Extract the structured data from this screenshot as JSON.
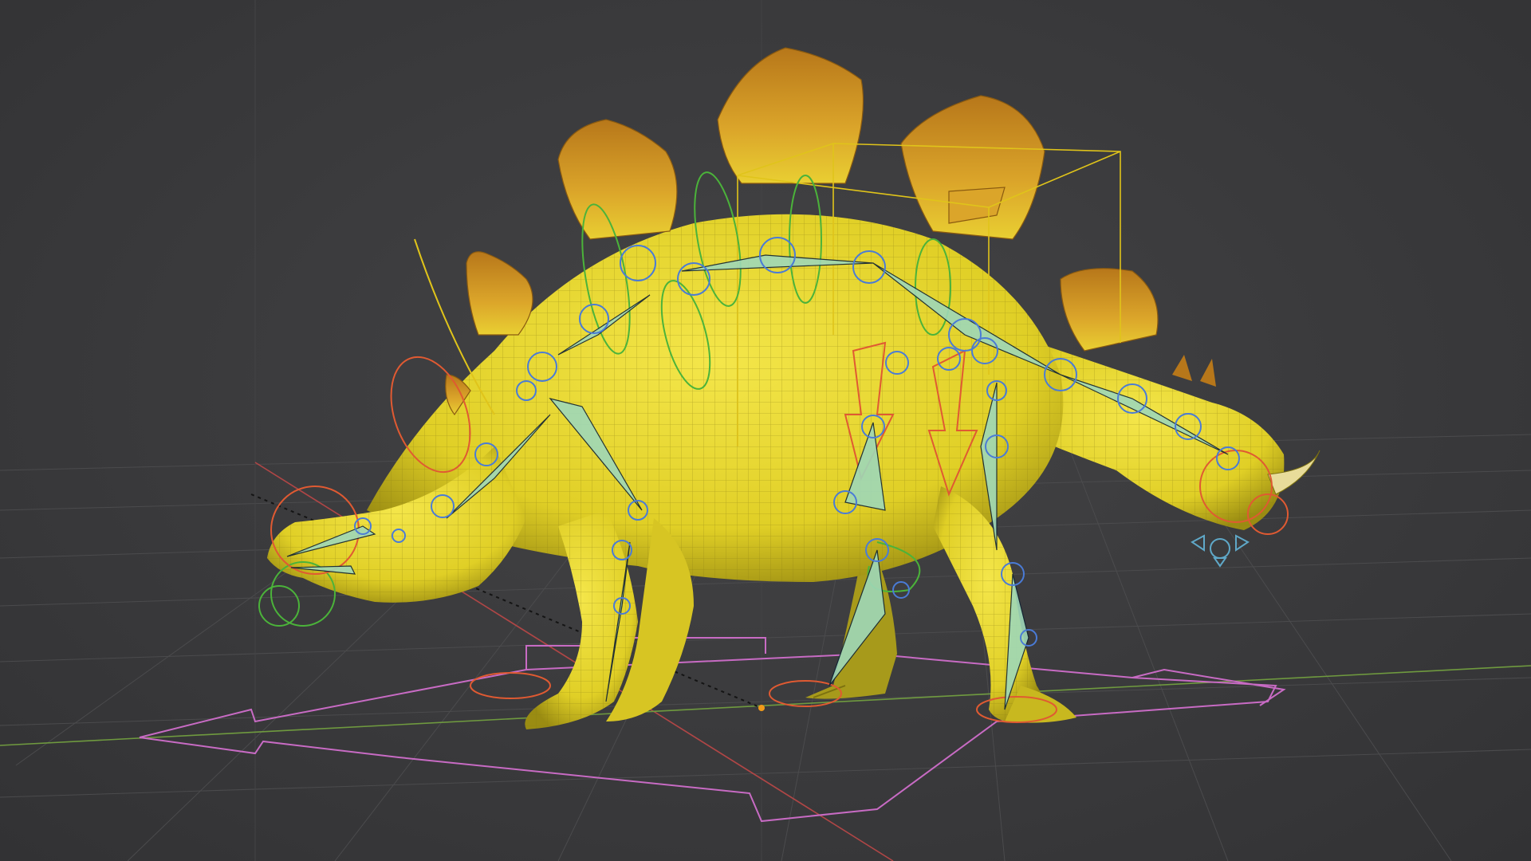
{
  "viewport": {
    "kind": "3d-viewport",
    "background_color": "#3a3a3c",
    "grid_color": "#4b4b4d",
    "x_axis_color": "#b04646",
    "y_axis_color": "#6f9a3f",
    "origin_color": "#f29b1a"
  },
  "model": {
    "subject": "stegosaurus",
    "mesh_color": "#e6d62a",
    "plate_color": "#d29a1f",
    "wireframe_color": "#8a7e14"
  },
  "rig": {
    "bone_color": "#9fd8b8",
    "joint_color": "#4a7bd6",
    "fk_control_color": "#4bb33a",
    "ik_control_color": "#e05a32",
    "root_control_color": "#c86bc4",
    "bounding_box_color": "#e0c41a"
  }
}
